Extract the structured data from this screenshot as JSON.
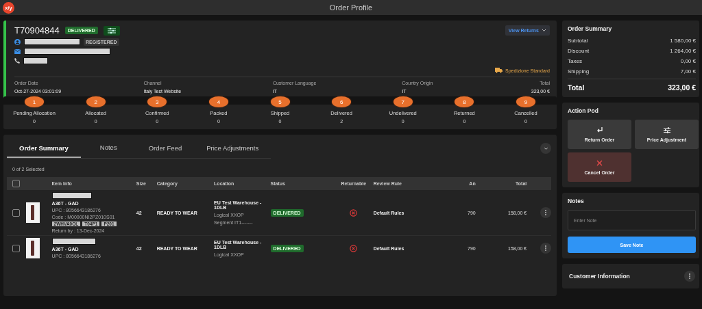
{
  "app": {
    "logo_text": "x/y",
    "title": "Order Profile"
  },
  "order": {
    "id": "T70904844",
    "status": "DELIVERED",
    "customer_badge": "REGISTERED",
    "view_returns": "View Returns",
    "shipping": "Spedizione Standard",
    "fields": [
      {
        "label": "Order Date",
        "value": "Oct-27-2024 03:01:09"
      },
      {
        "label": "Channel",
        "value": "Italy Test Website"
      },
      {
        "label": "Customer Language",
        "value": "IT"
      },
      {
        "label": "Country Origin",
        "value": "IT"
      },
      {
        "label": "Total",
        "value": "323,00 €"
      }
    ]
  },
  "steps": [
    {
      "number": "1",
      "label": "Pending Allocation",
      "count": "0"
    },
    {
      "number": "2",
      "label": "Allocated",
      "count": "0"
    },
    {
      "number": "3",
      "label": "Confirmed",
      "count": "0"
    },
    {
      "number": "4",
      "label": "Packed",
      "count": "0"
    },
    {
      "number": "5",
      "label": "Shipped",
      "count": "0"
    },
    {
      "number": "6",
      "label": "Delivered",
      "count": "2"
    },
    {
      "number": "7",
      "label": "Undelivered",
      "count": "0"
    },
    {
      "number": "8",
      "label": "Returned",
      "count": "0"
    },
    {
      "number": "9",
      "label": "Cancelled",
      "count": "0"
    }
  ],
  "tabs": [
    {
      "label": "Order Summary",
      "selected": true
    },
    {
      "label": "Notes",
      "selected": false
    },
    {
      "label": "Order Feed",
      "selected": false
    },
    {
      "label": "Price Adjustments",
      "selected": false
    }
  ],
  "selection": "0 of 2 Selected",
  "table": {
    "select_all_checked": false,
    "columns": [
      "Item Info",
      "Size",
      "Category",
      "Location",
      "Status",
      "Returnable",
      "Review Rule",
      "An",
      "Total"
    ],
    "rows": [
      {
        "checked": false,
        "name": "A36T - GAD",
        "upc": "UPC : 8056643186276",
        "code": "Code : M00000NI2PZ010S01",
        "tags": [
          "2WHVA0OL",
          "T04P1",
          "P201"
        ],
        "return_by": "Return by : 13-Dec-2024",
        "size": "42",
        "category": "READY TO WEAR",
        "location": [
          "EU Test Warehouse - 1DLB",
          "Logical XXOP",
          "Segment IT1-------"
        ],
        "status": "DELIVERED",
        "returnable": false,
        "review_rule": "Default Rules",
        "an": "790",
        "total": "158,00 €"
      },
      {
        "checked": false,
        "name": "A36T - GAD",
        "upc": "UPC : 8056643186276",
        "size": "42",
        "category": "READY TO WEAR",
        "location": [
          "EU Test Warehouse - 1DLB",
          "Logical XXOP"
        ],
        "status": "DELIVERED",
        "returnable": false,
        "review_rule": "Default Rules",
        "an": "790",
        "total": "158,00 €"
      }
    ]
  },
  "order_summary": {
    "title": "Order Summary",
    "lines": [
      {
        "label": "Subtotal",
        "value": "1 580,00 €"
      },
      {
        "label": "Discount",
        "value": "1 264,00 €"
      },
      {
        "label": "Taxes",
        "value": "0,00 €"
      },
      {
        "label": "Shipping",
        "value": "7,00 €"
      }
    ],
    "total_label": "Total",
    "total_value": "323,00 €"
  },
  "action_pod": {
    "title": "Action Pod",
    "actions": [
      {
        "label": "Return Order",
        "kind": "return"
      },
      {
        "label": "Price Adjustment",
        "kind": "adjust"
      },
      {
        "label": "Cancel Order",
        "kind": "cancel"
      }
    ]
  },
  "notes": {
    "title": "Notes",
    "placeholder": "Enter Note",
    "button": "Save Note"
  },
  "customer_info": {
    "title": "Customer Information"
  }
}
